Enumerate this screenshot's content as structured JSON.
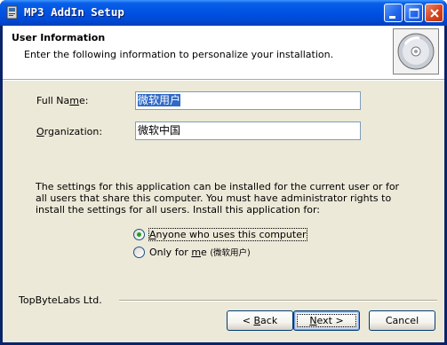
{
  "window": {
    "title": "MP3 AddIn Setup",
    "buttons": [
      "minimize",
      "maximize",
      "close"
    ]
  },
  "header": {
    "title": "User Information",
    "subtitle": "Enter the following information to personalize your installation."
  },
  "form": {
    "full_name": {
      "label_pre": "Full Na",
      "label_accel": "m",
      "label_post": "e:",
      "value": "微软用户"
    },
    "organization": {
      "label_pre": "",
      "label_accel": "O",
      "label_post": "rganization:",
      "value": "微软中国"
    }
  },
  "description": "The settings for this application can be installed for the current user or for all users that share this computer. You must have administrator rights to install the settings for all users. Install this application for:",
  "options": {
    "anyone": {
      "accel": "A",
      "rest": "nyone who uses this computer",
      "selected": true
    },
    "only_me": {
      "pre": "Only for ",
      "accel": "m",
      "post": "e ",
      "user": "(微软用户)",
      "selected": false
    }
  },
  "brand": "TopByteLabs Ltd.",
  "buttons": {
    "back": {
      "pre": "< ",
      "accel": "B",
      "post": "ack"
    },
    "next": {
      "accel": "N",
      "post": "ext >"
    },
    "cancel": {
      "label": "Cancel"
    }
  },
  "colors": {
    "titlebar": "#0053e3",
    "dialog_bg": "#ece9d8",
    "selection": "#316ac5",
    "radio_dot": "#21a121"
  }
}
